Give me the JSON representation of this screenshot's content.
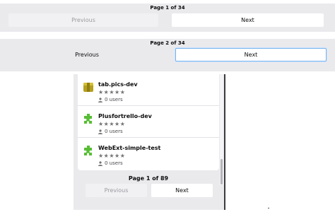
{
  "pager_top": {
    "title": "Page 1 of 34",
    "prev_label": "Previous",
    "next_label": "Next"
  },
  "pager_mid": {
    "title": "Page 2 of 34",
    "prev_label": "Previous",
    "next_label": "Next"
  },
  "addons": {
    "items": [
      {
        "name": "tab.pics-dev",
        "stars": "★★★★★",
        "users": "0 users",
        "icon": "package-icon"
      },
      {
        "name": "Plusfortrello-dev",
        "stars": "★★★★★",
        "users": "0 users",
        "icon": "puzzle-icon"
      },
      {
        "name": "WebExt-simple-test",
        "stars": "★★★★★",
        "users": "0 users",
        "icon": "puzzle-icon"
      }
    ],
    "pager": {
      "title": "Page 1 of 89",
      "prev_label": "Previous",
      "next_label": "Next"
    }
  },
  "colors": {
    "puzzle_green": "#57bd35",
    "package_gold": "#b5a01e",
    "focus_blue": "#7ab4ec"
  }
}
